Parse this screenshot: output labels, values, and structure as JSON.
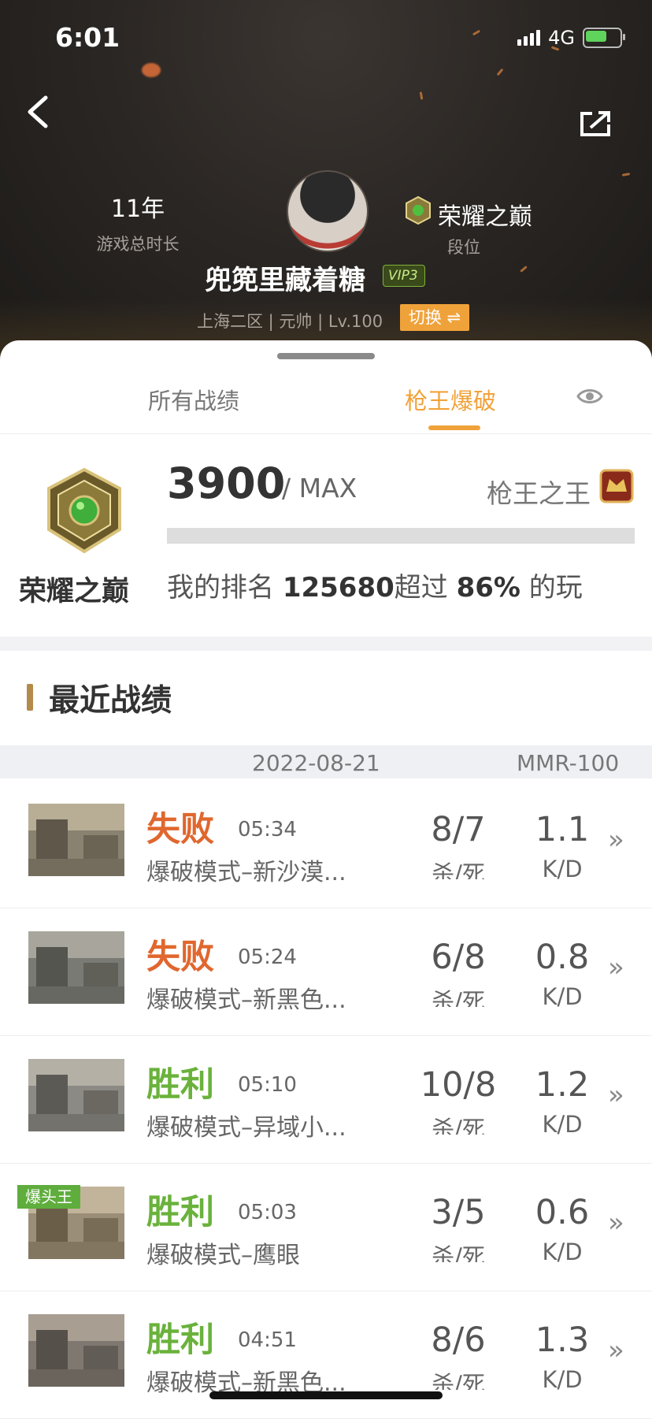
{
  "status": {
    "time": "6:01",
    "network": "4G"
  },
  "profile": {
    "years": "11年",
    "years_label": "游戏总时长",
    "rank_name": "荣耀之巅",
    "rank_label": "段位",
    "nickname": "兜篼里藏着糖",
    "vip": "VIP3",
    "server_info": "上海二区 | 元帅 | Lv.100",
    "switch_label": "切换 ⇌"
  },
  "tabs": {
    "all": "所有战绩",
    "active": "枪王爆破"
  },
  "summary": {
    "medal_name": "荣耀之巅",
    "score": "3900",
    "score_max": "/ MAX",
    "king_label": "枪王之王",
    "progress": 0,
    "ranking_prefix": "我的排名 ",
    "ranking_number": "125680",
    "ranking_mid": "超过 ",
    "ranking_percent": "86%",
    "ranking_suffix": " 的玩"
  },
  "recent": {
    "title": "最近战绩",
    "date": "2022-08-21",
    "mmr": "MMR-100",
    "kills_label": "杀/死",
    "kd_label": "K/D",
    "tag_label": "爆头王",
    "rows": [
      {
        "result": "失败",
        "duration": "05:34",
        "mode": "爆破模式–新沙漠...",
        "kills": "8/7",
        "ratio": "1.1"
      },
      {
        "result": "失败",
        "duration": "05:24",
        "mode": "爆破模式–新黑色...",
        "kills": "6/8",
        "ratio": "0.8"
      },
      {
        "result": "胜利",
        "duration": "05:10",
        "mode": "爆破模式–异域小...",
        "kills": "10/8",
        "ratio": "1.2"
      },
      {
        "result": "胜利",
        "duration": "05:03",
        "mode": "爆破模式–鹰眼",
        "kills": "3/5",
        "ratio": "0.6"
      },
      {
        "result": "胜利",
        "duration": "04:51",
        "mode": "爆破模式–新黑色...",
        "kills": "8/6",
        "ratio": "1.3"
      }
    ]
  },
  "colors": {
    "accent": "#f0a23a",
    "lose": "#e0672e",
    "win": "#6ab23c"
  }
}
